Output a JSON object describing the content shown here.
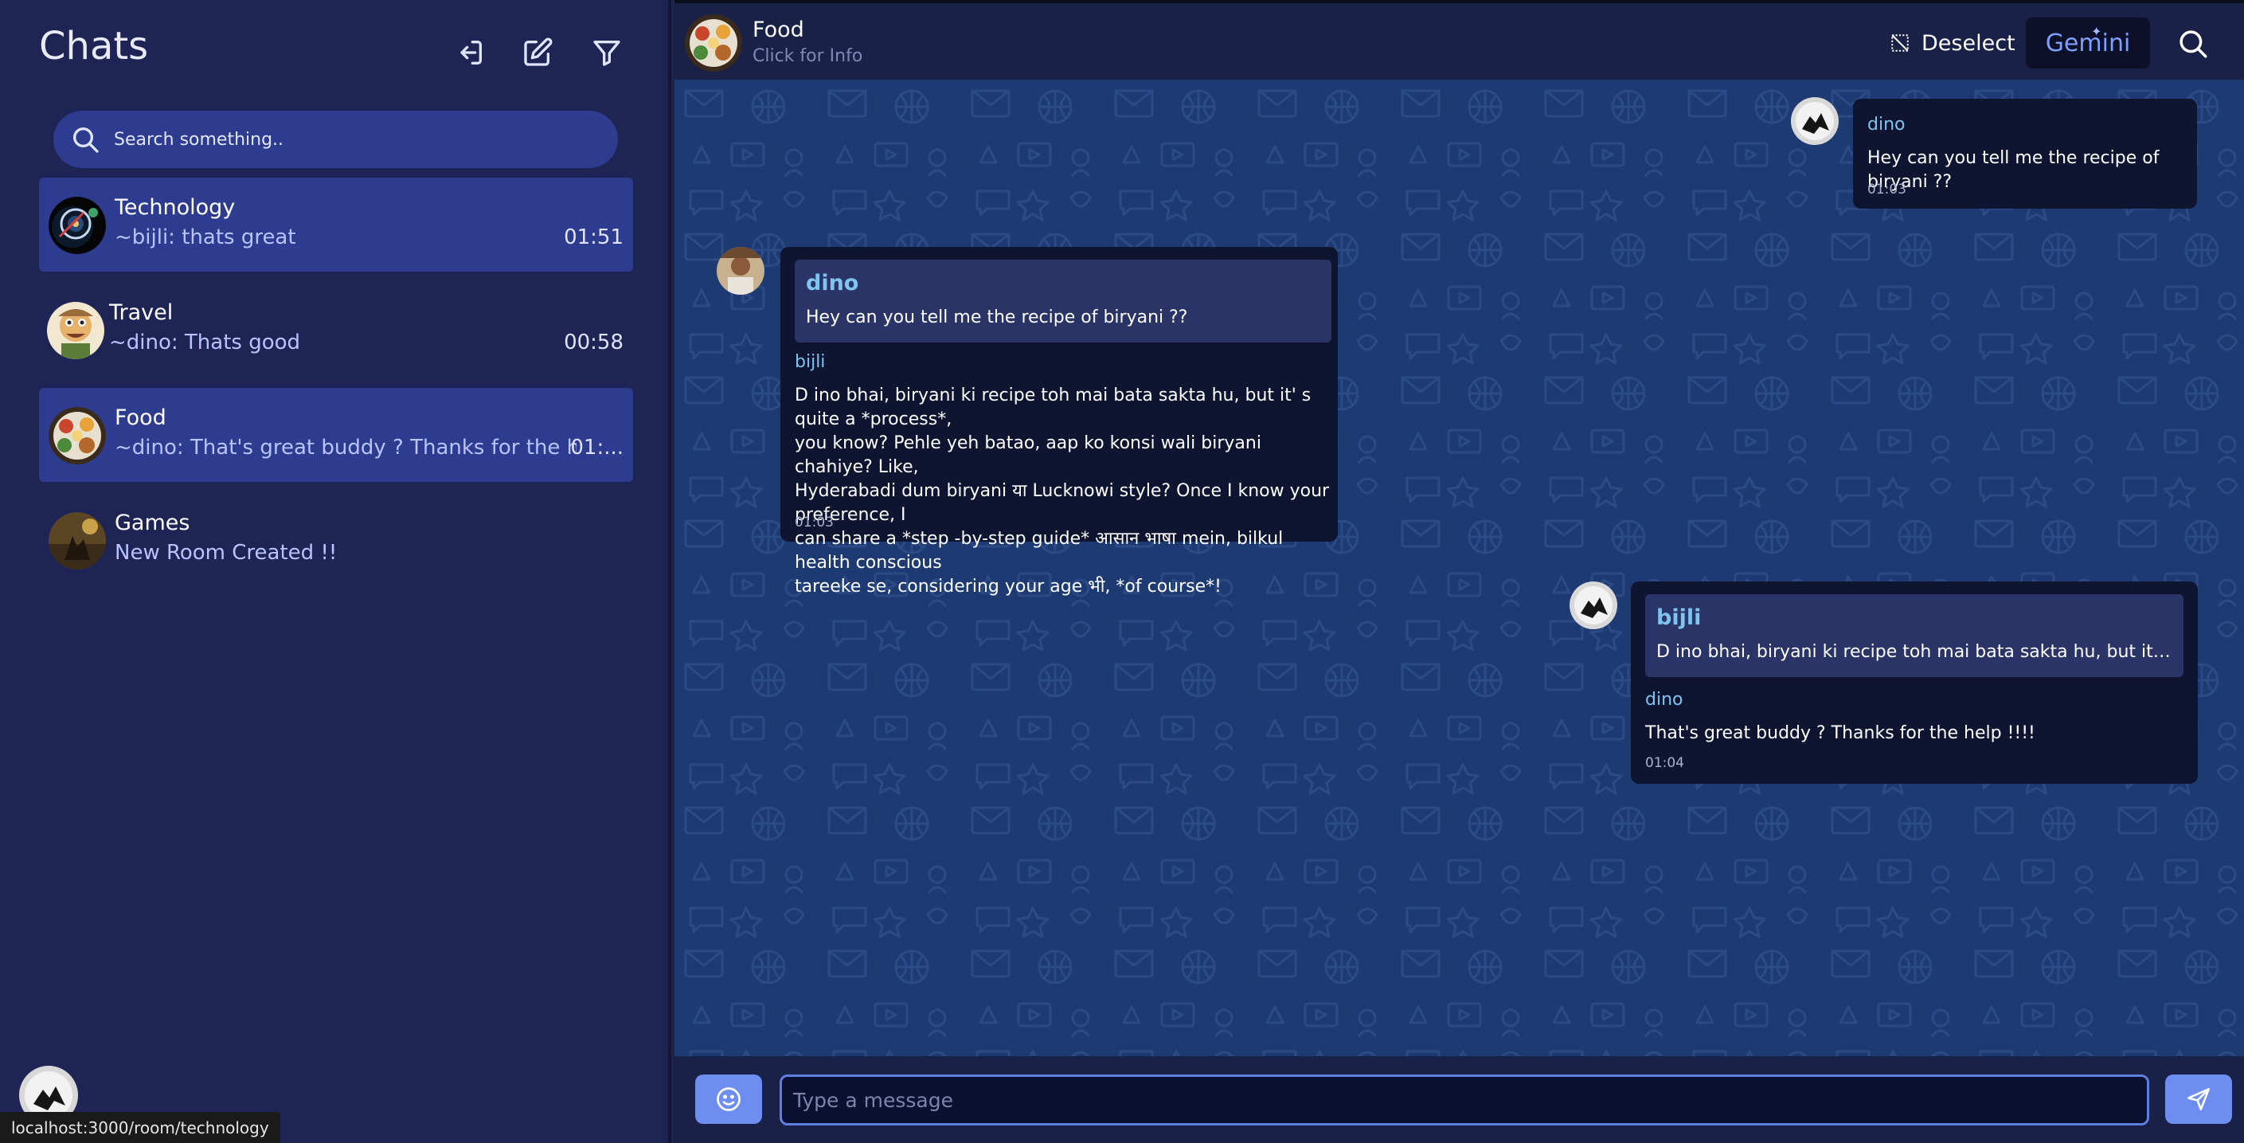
{
  "sidebar": {
    "title": "Chats",
    "search_placeholder": "Search something..",
    "chats": [
      {
        "name": "Technology",
        "preview": "~bijli:  thats great",
        "time": "01:51",
        "active": true
      },
      {
        "name": "Travel",
        "preview": "~dino:  Thats good",
        "time": "00:58",
        "active": false
      },
      {
        "name": "Food",
        "preview": "~dino:  That's great buddy ? Thanks for the help...",
        "time": "01:...",
        "active": true
      },
      {
        "name": "Games",
        "preview": "New Room Created !!",
        "time": "",
        "active": false
      }
    ]
  },
  "status_bar": {
    "url": "localhost:3000/room/technology"
  },
  "header": {
    "title": "Food",
    "subtitle": "Click for Info",
    "deselect_label": "Deselect",
    "gemini_label": "Gemini"
  },
  "messages": [
    {
      "sender": "dino",
      "text": "Hey can you tell me the recipe of biryani ??",
      "time": "01:03"
    },
    {
      "quote": {
        "sender": "dino",
        "text": "Hey can you tell me the recipe of biryani ??"
      },
      "sender": "bijli",
      "lines": [
        "D ino bhai, biryani ki recipe toh mai bata sakta hu, but it' s quite a *process*,",
        "you know? Pehle yeh batao, aap ko konsi wali biryani chahiye? Like,",
        "Hyderabadi dum biryani या Lucknowi style? Once I know your preference, I",
        "can share a *step -by-step guide* आसान भाषा mein, bilkul health conscious",
        "tareeke se, considering your age भी, *of course*!"
      ],
      "time": "01:03"
    },
    {
      "quote": {
        "sender": "bijli",
        "text": "D ino bhai, biryani ki recipe toh mai bata sakta hu, but it' s q..."
      },
      "sender": "dino",
      "text": "That's great buddy ? Thanks for the help !!!!",
      "time": "01:04"
    }
  ],
  "composer": {
    "placeholder": "Type a message"
  },
  "colors": {
    "sidebar": "#1e2554",
    "active_item": "#2e3c8f",
    "chat_bg": "#1e3a73",
    "accent": "#6d8df0",
    "sender": "#7fc3ef"
  }
}
